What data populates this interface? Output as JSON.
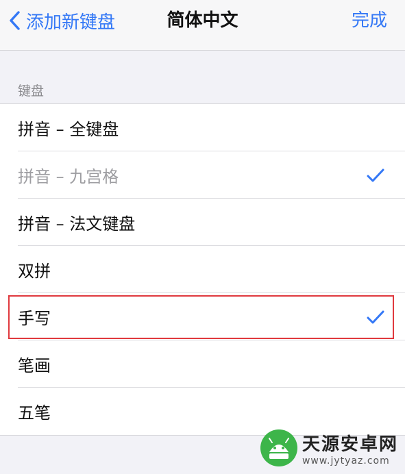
{
  "colors": {
    "accent": "#3478f6",
    "highlight_border": "#e0393e",
    "background": "#f2f2f7"
  },
  "navbar": {
    "back_label": "添加新键盘",
    "back_icon": "chevron-left-icon",
    "title": "简体中文",
    "done_label": "完成"
  },
  "section": {
    "header": "键盘",
    "items": [
      {
        "label": "拼音 – 全键盘",
        "checked": false,
        "disabled": false
      },
      {
        "label": "拼音 – 九宫格",
        "checked": true,
        "disabled": true
      },
      {
        "label": "拼音 – 法文键盘",
        "checked": false,
        "disabled": false
      },
      {
        "label": "双拼",
        "checked": false,
        "disabled": false
      },
      {
        "label": "手写",
        "checked": true,
        "disabled": false
      },
      {
        "label": "笔画",
        "checked": false,
        "disabled": false
      },
      {
        "label": "五笔",
        "checked": false,
        "disabled": false
      }
    ]
  },
  "watermark": {
    "title": "天源安卓网",
    "url": "www.jytyaz.com"
  }
}
